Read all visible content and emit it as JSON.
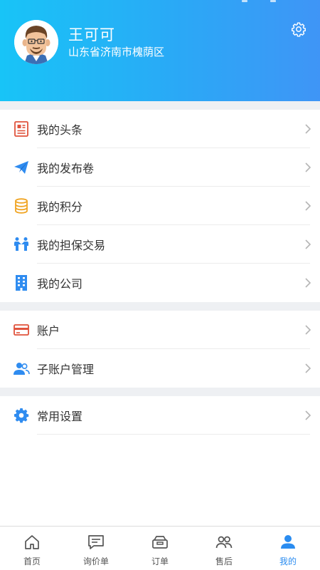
{
  "profile": {
    "name": "王可可",
    "location": "山东省济南市槐荫区",
    "avatar_icon": "cartoon-man-avatar",
    "settings_icon": "gear-icon"
  },
  "menu_groups": [
    {
      "items": [
        {
          "label": "我的头条",
          "icon": "headline-icon",
          "color": "#e0533d"
        },
        {
          "label": "我的发布卷",
          "icon": "paper-plane-icon",
          "color": "#2f8cf0"
        },
        {
          "label": "我的积分",
          "icon": "database-icon",
          "color": "#f0a524"
        },
        {
          "label": "我的担保交易",
          "icon": "handshake-icon",
          "color": "#2f8cf0"
        },
        {
          "label": "我的公司",
          "icon": "building-icon",
          "color": "#2f8cf0"
        }
      ]
    },
    {
      "items": [
        {
          "label": "账户",
          "icon": "credit-card-icon",
          "color": "#e0533d"
        },
        {
          "label": "子账户管理",
          "icon": "users-icon",
          "color": "#2f8cf0"
        }
      ]
    },
    {
      "items": [
        {
          "label": "常用设置",
          "icon": "gear-icon",
          "color": "#2f8cf0"
        }
      ]
    }
  ],
  "tabs": [
    {
      "label": "首页",
      "icon": "home-icon",
      "active": false
    },
    {
      "label": "询价单",
      "icon": "message-icon",
      "active": false
    },
    {
      "label": "订单",
      "icon": "order-box-icon",
      "active": false
    },
    {
      "label": "售后",
      "icon": "service-users-icon",
      "active": false
    },
    {
      "label": "我的",
      "icon": "person-icon",
      "active": true
    }
  ],
  "colors": {
    "header_start": "#18c4f7",
    "header_end": "#3f95f6",
    "accent": "#2a8cf0",
    "background_gap": "#eef0f3"
  }
}
